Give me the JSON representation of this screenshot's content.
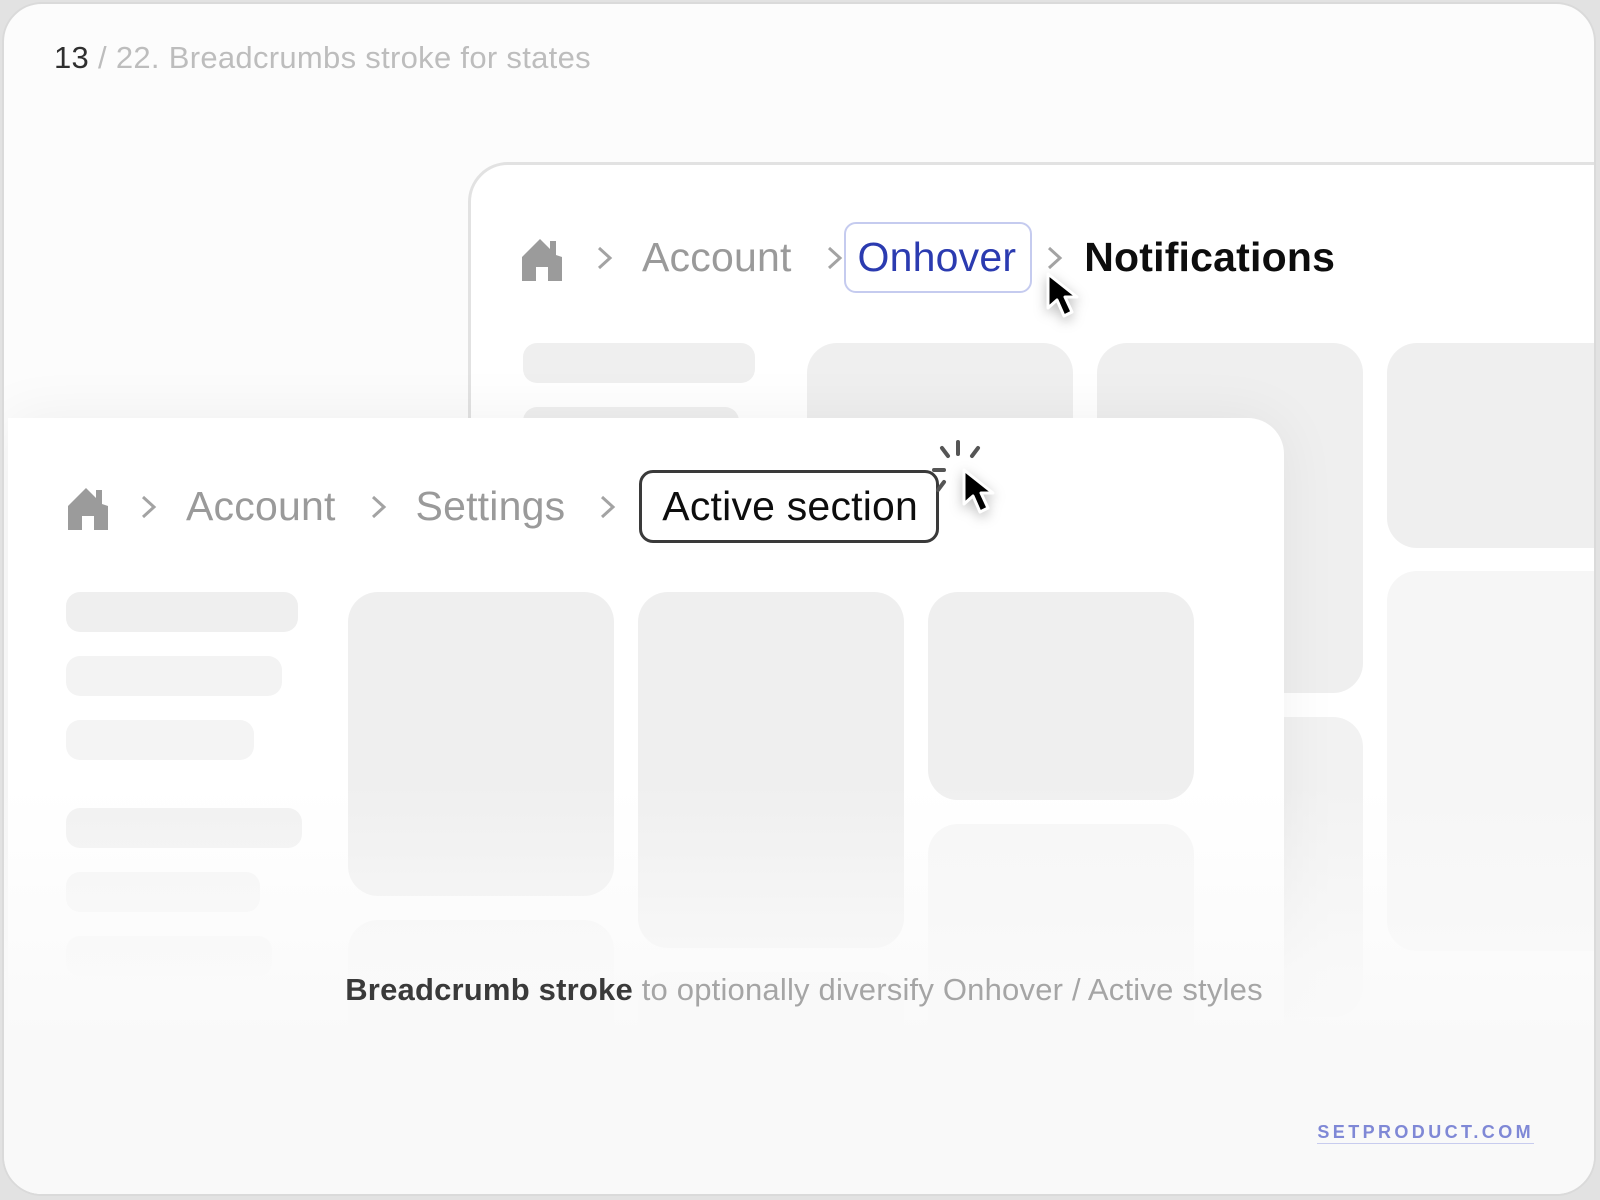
{
  "slide": {
    "number": "13",
    "title_rest": " / 22. Breadcrumbs stroke for states"
  },
  "back_card": {
    "breadcrumb": {
      "home_icon": "home-icon",
      "items": [
        {
          "label": "Account",
          "state": "default"
        },
        {
          "label": "Onhover",
          "state": "hover"
        },
        {
          "label": "Notifications",
          "state": "current"
        }
      ],
      "separator_icon": "chevron-right-icon"
    }
  },
  "front_card": {
    "breadcrumb": {
      "home_icon": "home-icon",
      "items": [
        {
          "label": "Account",
          "state": "default"
        },
        {
          "label": "Settings",
          "state": "default"
        },
        {
          "label": "Active section",
          "state": "active"
        }
      ],
      "separator_icon": "chevron-right-icon"
    }
  },
  "caption": {
    "bold": "Breadcrumb stroke",
    "rest": " to optionally diversify Onhover / Active styles"
  },
  "brand": "SETPRODUCT.COM",
  "colors": {
    "hover_text": "#2b3bb0",
    "hover_stroke": "#c5cbef",
    "active_stroke": "#3a3a3a",
    "crumb_default": "#9a9a9a",
    "brand": "#7f88d6"
  }
}
